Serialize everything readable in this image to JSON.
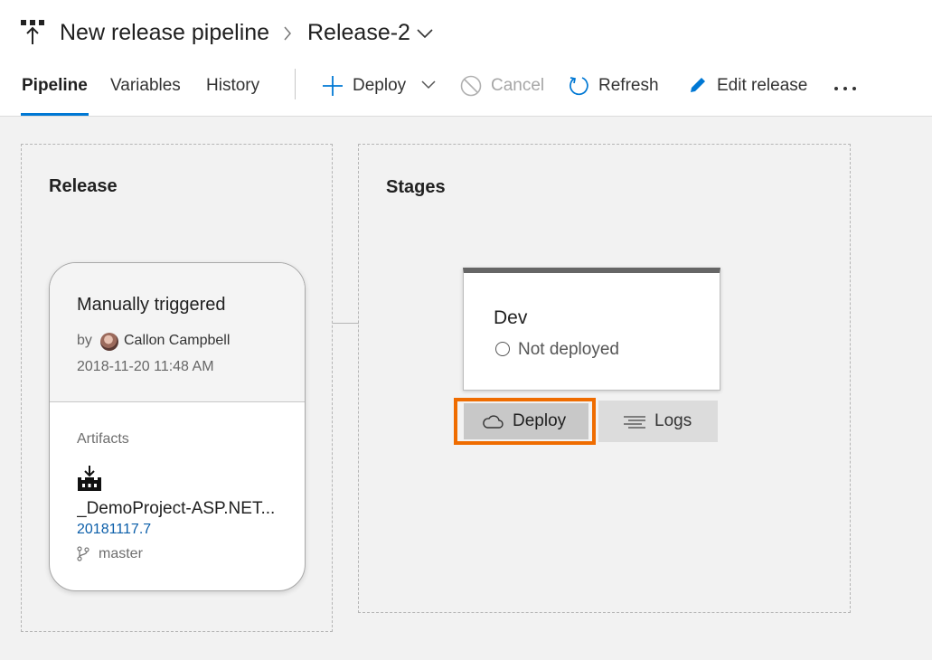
{
  "header": {
    "pipeline_name": "New release pipeline",
    "release_name": "Release-2"
  },
  "tabs": [
    {
      "label": "Pipeline",
      "active": true
    },
    {
      "label": "Variables",
      "active": false
    },
    {
      "label": "History",
      "active": false
    }
  ],
  "toolbar": {
    "deploy_label": "Deploy",
    "cancel_label": "Cancel",
    "refresh_label": "Refresh",
    "edit_label": "Edit release",
    "more_label": "..."
  },
  "release_panel": {
    "title": "Release",
    "trigger": "Manually triggered",
    "by_label": "by",
    "author": "Callon Campbell",
    "date": "2018-11-20 11:48 AM",
    "artifacts_label": "Artifacts",
    "artifact_name": "_DemoProject-ASP.NET...",
    "artifact_version": "20181117.7",
    "artifact_branch": "master"
  },
  "stages_panel": {
    "title": "Stages",
    "stage_name": "Dev",
    "stage_status": "Not deployed",
    "deploy_button": "Deploy",
    "logs_button": "Logs"
  },
  "colors": {
    "accent": "#0078d4",
    "highlight": "#ef6c00",
    "link": "#0b5ea9"
  }
}
